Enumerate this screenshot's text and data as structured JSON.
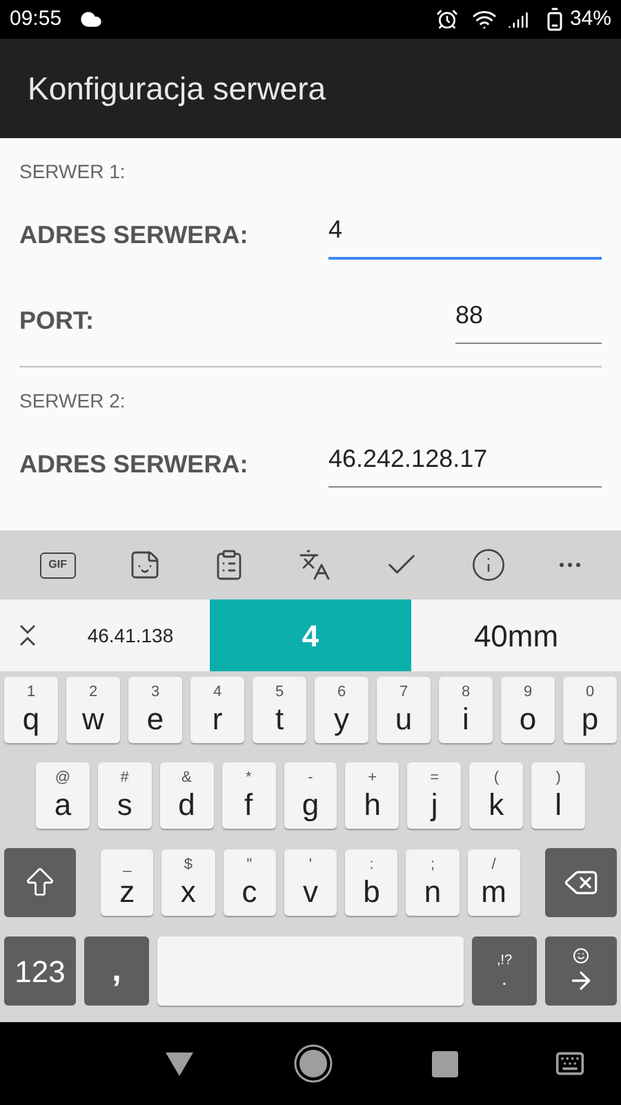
{
  "status_bar": {
    "time": "09:55",
    "battery": "34%"
  },
  "app_bar": {
    "title": "Konfiguracja serwera"
  },
  "sections": [
    {
      "header": "SERWER 1:",
      "fields": [
        {
          "kind": "wide",
          "label": "ADRES SERWERA:",
          "value": "4",
          "focused": true
        },
        {
          "kind": "narrow",
          "label": "PORT:",
          "value": "88",
          "focused": false
        }
      ]
    },
    {
      "header": "SERWER 2:",
      "fields": [
        {
          "kind": "wide",
          "label": "ADRES SERWERA:",
          "value": "46.242.128.17",
          "focused": false
        }
      ]
    }
  ],
  "toolbar": {
    "gif_label": "GIF"
  },
  "suggestions": [
    {
      "text": "46.41.138",
      "selected": false
    },
    {
      "text": "4",
      "selected": true
    },
    {
      "text": "40mm",
      "selected": false
    }
  ],
  "key_rows": [
    [
      {
        "hint": "1",
        "main": "q"
      },
      {
        "hint": "2",
        "main": "w"
      },
      {
        "hint": "3",
        "main": "e"
      },
      {
        "hint": "4",
        "main": "r"
      },
      {
        "hint": "5",
        "main": "t"
      },
      {
        "hint": "6",
        "main": "y"
      },
      {
        "hint": "7",
        "main": "u"
      },
      {
        "hint": "8",
        "main": "i"
      },
      {
        "hint": "9",
        "main": "o"
      },
      {
        "hint": "0",
        "main": "p"
      }
    ],
    [
      {
        "hint": "@",
        "main": "a"
      },
      {
        "hint": "#",
        "main": "s"
      },
      {
        "hint": "&",
        "main": "d"
      },
      {
        "hint": "*",
        "main": "f"
      },
      {
        "hint": "-",
        "main": "g"
      },
      {
        "hint": "+",
        "main": "h"
      },
      {
        "hint": "=",
        "main": "j"
      },
      {
        "hint": "(",
        "main": "k"
      },
      {
        "hint": ")",
        "main": "l"
      }
    ],
    [
      {
        "hint": "_",
        "main": "z"
      },
      {
        "hint": "$",
        "main": "x"
      },
      {
        "hint": "\"",
        "main": "c"
      },
      {
        "hint": "'",
        "main": "v"
      },
      {
        "hint": ":",
        "main": "b"
      },
      {
        "hint": ";",
        "main": "n"
      },
      {
        "hint": "/",
        "main": "m"
      }
    ]
  ],
  "bottom_row": [
    {
      "kind": "symbols",
      "main": "123"
    },
    {
      "kind": "comma",
      "main": ","
    },
    {
      "kind": "space"
    },
    {
      "kind": "period",
      "hint": ",!?",
      "main": "."
    },
    {
      "kind": "enter"
    }
  ]
}
